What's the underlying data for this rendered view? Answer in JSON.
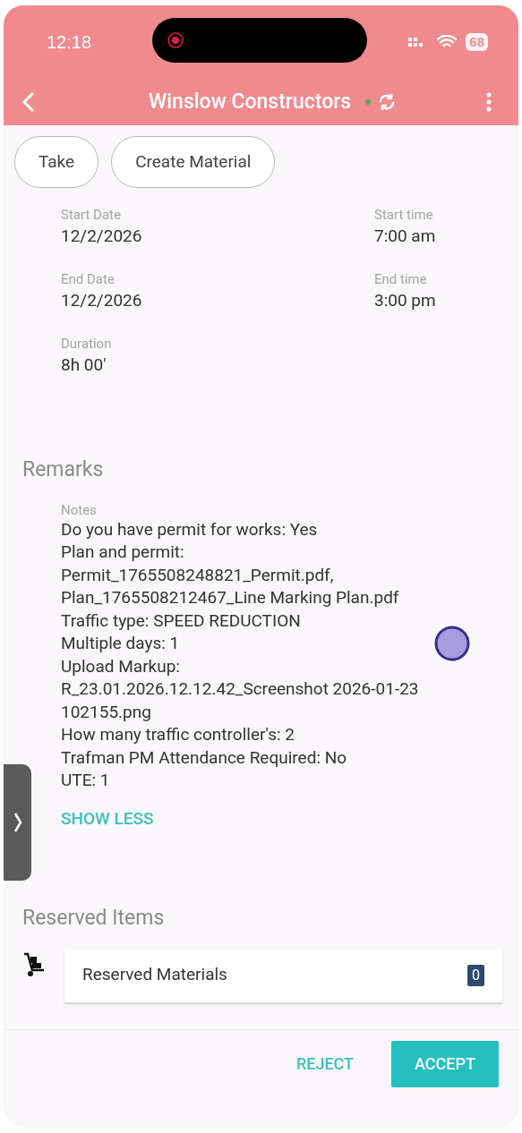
{
  "status_bar": {
    "time": "12:18",
    "battery": "68"
  },
  "header": {
    "title": "Winslow Constructors"
  },
  "actions": [
    "Take",
    "Create Material"
  ],
  "fields": [
    {
      "label": "Start Date",
      "value": "12/2/2026"
    },
    {
      "label": "Start time",
      "value": "7:00 am"
    },
    {
      "label": "End Date",
      "value": "12/2/2026"
    },
    {
      "label": "End time",
      "value": "3:00 pm"
    },
    {
      "label": "Duration",
      "value": "8h 00'"
    }
  ],
  "remarks": {
    "heading": "Remarks",
    "label": "Notes",
    "lines": [
      "Do you have permit for works: Yes",
      "Plan and permit:",
      "Permit_1765508248821_Permit.pdf,",
      "Plan_1765508212467_Line Marking Plan.pdf",
      "Traffic type: SPEED REDUCTION",
      "Multiple days: 1",
      "Upload Markup:",
      "R_23.01.2026.12.12.42_Screenshot 2026-01-23",
      "102155.png",
      "How many traffic controller's: 2",
      "Trafman PM Attendance Required: No",
      "UTE: 1"
    ],
    "toggle": "SHOW LESS"
  },
  "reserved": {
    "heading": "Reserved Items",
    "items": [
      {
        "label": "Reserved Materials",
        "count": "0"
      }
    ]
  },
  "footer": {
    "buttons": [
      {
        "label": "REJECT",
        "kind": "text"
      },
      {
        "label": "ACCEPT",
        "kind": "filled"
      }
    ]
  }
}
